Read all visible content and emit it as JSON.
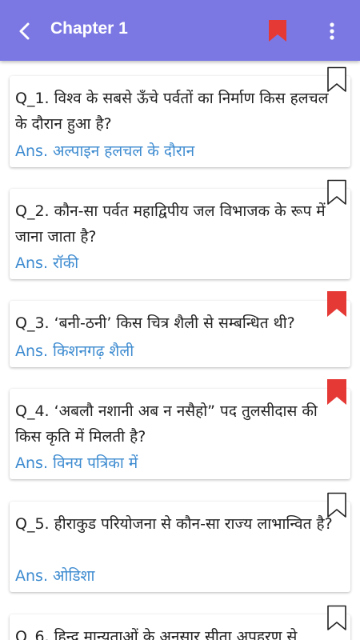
{
  "header": {
    "title": "Chapter 1",
    "accent_color": "#7b78e3",
    "bookmark_color": "#e53935"
  },
  "questions": [
    {
      "question": "Q_1. विश्व के सबसे ऊँचे पर्वतों का निर्माण किस हलचल के दौरान हुआ है?",
      "answer": "Ans. अल्पाइन हलचल के दौरान",
      "bookmarked": false
    },
    {
      "question": "Q_2. कौन-सा पर्वत महाद्विपीय जल विभाजक के रूप में जाना जाता है?",
      "answer": "Ans. रॉकी",
      "bookmarked": false
    },
    {
      "question": "Q_3. ‘बनी-ठनी’ किस चित्र शैली से सम्बन्धित थी?",
      "answer": "Ans. किशनगढ़ शैली",
      "bookmarked": true
    },
    {
      "question": "Q_4. ‘अबलौ नशानी अब न नसैहो” पद तुलसीदास की किस कृति में मिलती है?",
      "answer": "Ans. विनय पत्रिका में",
      "bookmarked": true
    },
    {
      "question": "Q_5. हीराकुड परियोजना से कौन-सा राज्य लाभान्वित है?",
      "answer": "Ans. ओडिशा",
      "bookmarked": false
    },
    {
      "question": "Q_6. हिन्दू मान्यताओं के अनुसार सीता अपहरण से",
      "answer": "",
      "bookmarked": false
    }
  ]
}
